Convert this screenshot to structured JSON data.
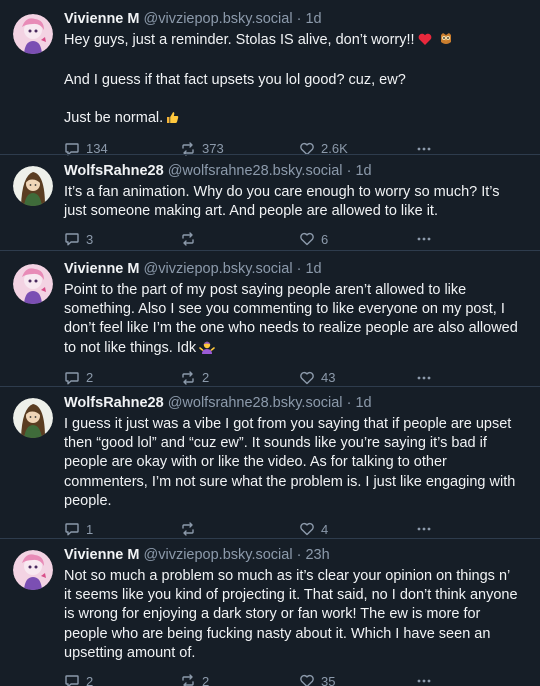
{
  "posts": [
    {
      "author_name": "Vivienne M",
      "author_handle": "@vivziepop.bsky.social",
      "time": "1d",
      "paragraphs": [
        "Hey guys, just a reminder. Stolas IS alive, don’t worry!!",
        "And I guess if that fact upsets you lol good? cuz, ew?",
        "Just be normal."
      ],
      "emojis_after_p1": [
        "red-heart",
        "owl"
      ],
      "emoji_after_p3": "thumbs-up",
      "reply_count": "134",
      "repost_count": "373",
      "like_count": "2.6K"
    },
    {
      "author_name": "WolfsRahne28",
      "author_handle": "@wolfsrahne28.bsky.social",
      "time": "1d",
      "paragraphs": [
        "It’s a fan animation. Why do you care enough to worry so much? It’s just someone making art. And people are allowed to like it."
      ],
      "reply_count": "3",
      "repost_count": "",
      "like_count": "6"
    },
    {
      "author_name": "Vivienne M",
      "author_handle": "@vivziepop.bsky.social",
      "time": "1d",
      "paragraphs": [
        "Point to the part of my post saying people aren’t allowed to like something. Also I see you commenting to like everyone on my post, I don’t feel like I’m the one who needs to realize people are also allowed to not like things. Idk"
      ],
      "emoji_after_p1": "person-shrugging",
      "reply_count": "2",
      "repost_count": "2",
      "like_count": "43"
    },
    {
      "author_name": "WolfsRahne28",
      "author_handle": "@wolfsrahne28.bsky.social",
      "time": "1d",
      "paragraphs": [
        "I guess it just was a vibe I got from you saying that if people are upset then “good lol” and “cuz ew”. It sounds like you’re saying it’s bad if people are okay with or like the video. As for talking to other commenters, I’m not sure what the problem is. I just like engaging with people."
      ],
      "reply_count": "1",
      "repost_count": "",
      "like_count": "4"
    },
    {
      "author_name": "Vivienne M",
      "author_handle": "@vivziepop.bsky.social",
      "time": "23h",
      "paragraphs": [
        "Not so much a problem so much as it’s clear your opinion on things n’ it seems like you kind of projecting it. That said, no I don’t think anyone is wrong for enjoying a dark story or fan work! The ew is more for people who are being fucking nasty about it. Which I have seen an upsetting amount of."
      ],
      "reply_count": "2",
      "repost_count": "2",
      "like_count": "35"
    }
  ],
  "dot_separator": "·",
  "colors": {
    "background": "#161e27",
    "text": "#f1f3f5",
    "muted": "#8c9aab",
    "divider": "#2e3c4d"
  }
}
